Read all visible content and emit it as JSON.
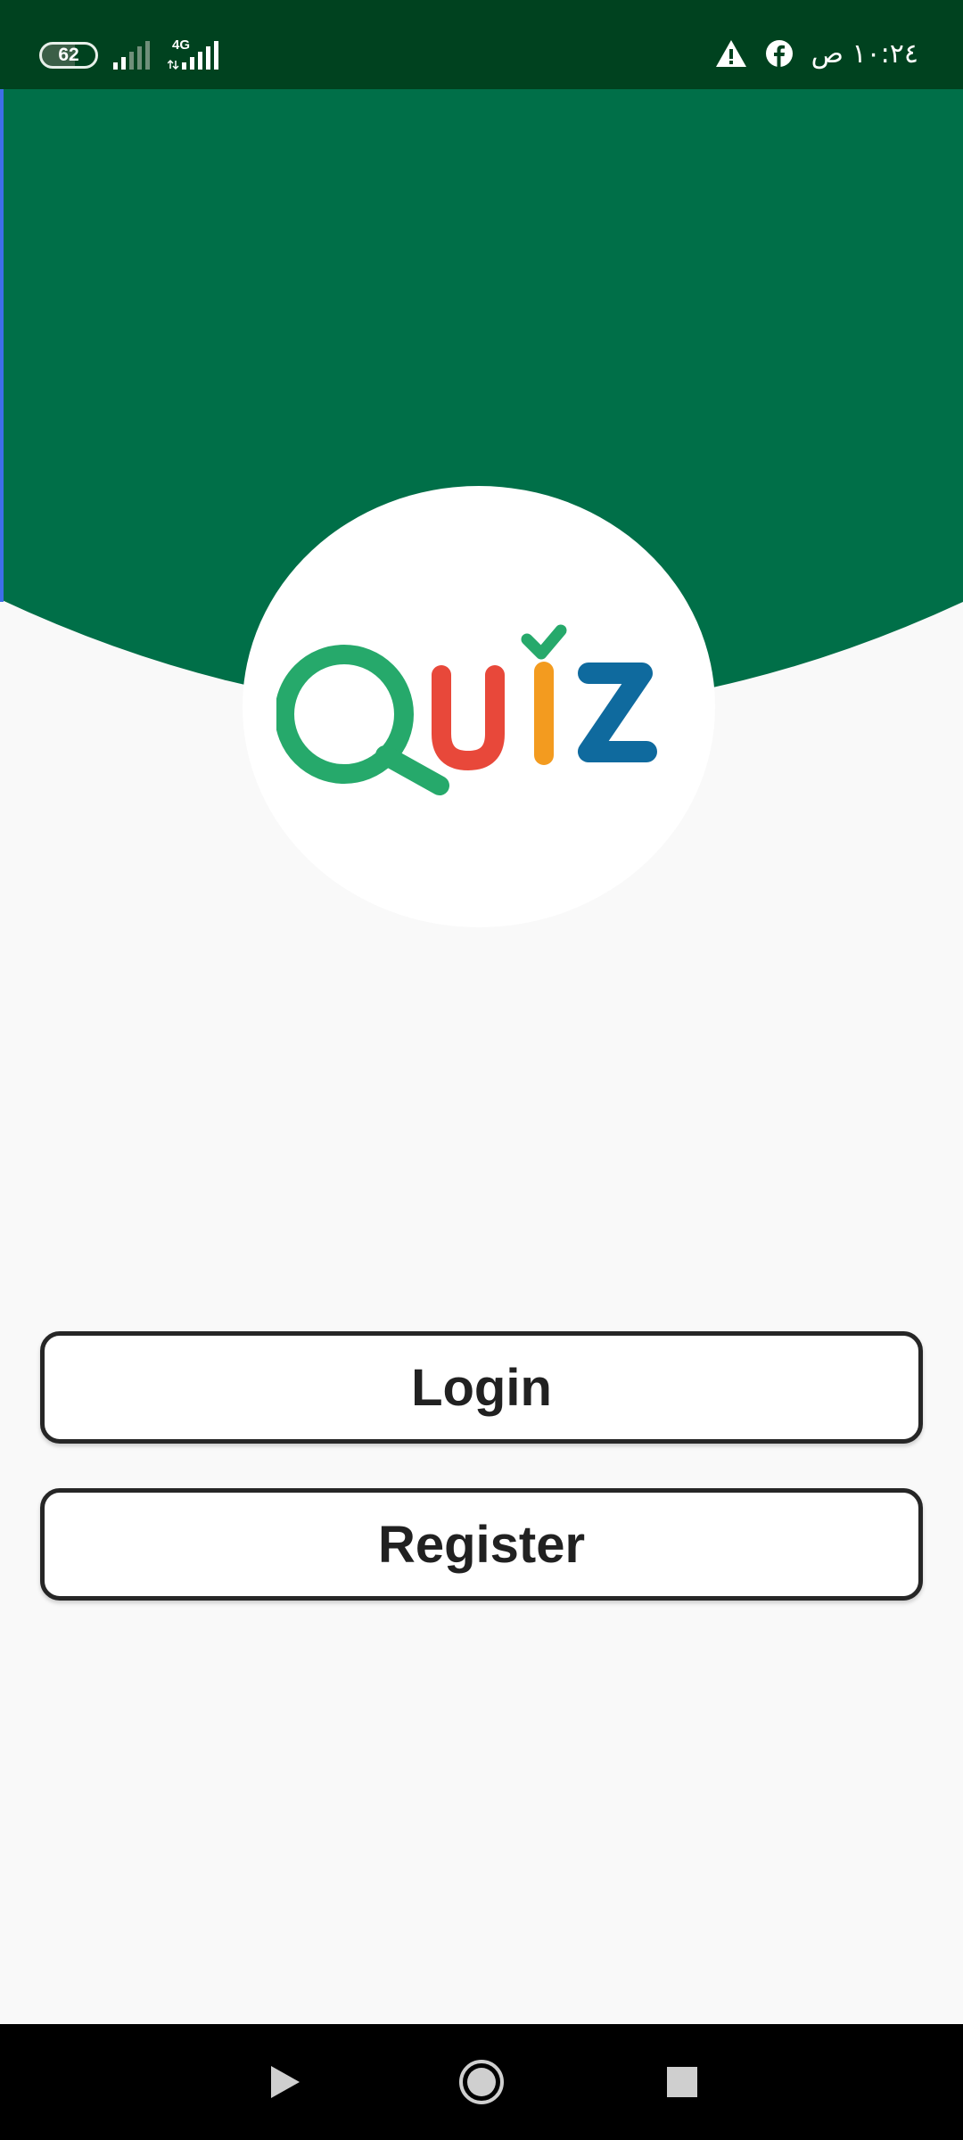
{
  "status_bar": {
    "battery_level": "62",
    "network_type": "4G",
    "time": "١٠:٢٤ ص",
    "icons": [
      "battery-icon",
      "signal-icon",
      "signal-4g-icon",
      "warning-icon",
      "facebook-icon"
    ]
  },
  "logo": {
    "text": "Quiz",
    "colors": {
      "q": "#26a96b",
      "u": "#e8483a",
      "i": "#f39b1f",
      "z": "#0f6a9e",
      "check": "#26a96b"
    }
  },
  "buttons": {
    "login_label": "Login",
    "register_label": "Register"
  },
  "nav": {
    "icons": [
      "back-icon",
      "home-icon",
      "recents-icon"
    ]
  },
  "colors": {
    "header": "#006f48",
    "status_bar": "#00421f",
    "background": "#f9f9f9"
  }
}
